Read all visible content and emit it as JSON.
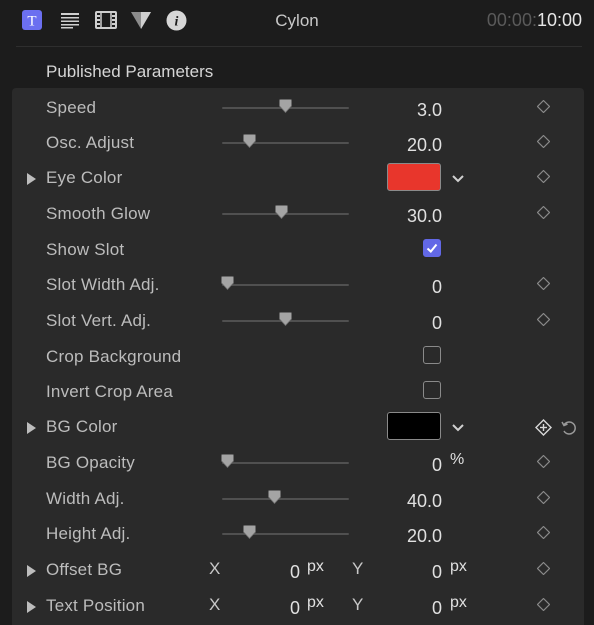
{
  "toolbar": {
    "title": "Cylon",
    "time_dim": "00:00:",
    "time_main": "10:00",
    "icons": [
      "text-inspector-icon",
      "lines-icon",
      "film-icon",
      "filter-icon",
      "info-icon"
    ],
    "text_icon_glyph": "T",
    "info_icon_glyph": "i"
  },
  "section": {
    "title": "Published Parameters"
  },
  "params": {
    "speed": {
      "label": "Speed",
      "value": "3.0",
      "level": 0.5
    },
    "osc": {
      "label": "Osc. Adjust",
      "value": "20.0",
      "level": 0.22
    },
    "eye_color": {
      "label": "Eye Color",
      "color": "#e8362c"
    },
    "smooth_glow": {
      "label": "Smooth Glow",
      "value": "30.0",
      "level": 0.47
    },
    "show_slot": {
      "label": "Show Slot",
      "checked": true
    },
    "slot_width": {
      "label": "Slot Width Adj.",
      "value": "0",
      "level": 0.04
    },
    "slot_vert": {
      "label": "Slot Vert. Adj.",
      "value": "0",
      "level": 0.5
    },
    "crop_bg": {
      "label": "Crop Background",
      "checked": false
    },
    "invert_crop": {
      "label": "Invert Crop Area",
      "checked": false
    },
    "bg_color": {
      "label": "BG Color",
      "color": "#000000"
    },
    "bg_opacity": {
      "label": "BG Opacity",
      "value": "0",
      "unit": "%",
      "level": 0.04
    },
    "width_adj": {
      "label": "Width Adj.",
      "value": "40.0",
      "level": 0.41
    },
    "height_adj": {
      "label": "Height Adj.",
      "value": "20.0",
      "level": 0.22
    },
    "offset_bg": {
      "label": "Offset BG",
      "x_label": "X",
      "x_value": "0",
      "x_unit": "px",
      "y_label": "Y",
      "y_value": "0",
      "y_unit": "px"
    },
    "text_pos": {
      "label": "Text Position",
      "x_label": "X",
      "x_value": "0",
      "x_unit": "px",
      "y_label": "Y",
      "y_value": "0",
      "y_unit": "px"
    }
  },
  "colors": {
    "accent": "#6268e6",
    "panel": "#2a2a2a",
    "background": "#1c1c1c"
  }
}
